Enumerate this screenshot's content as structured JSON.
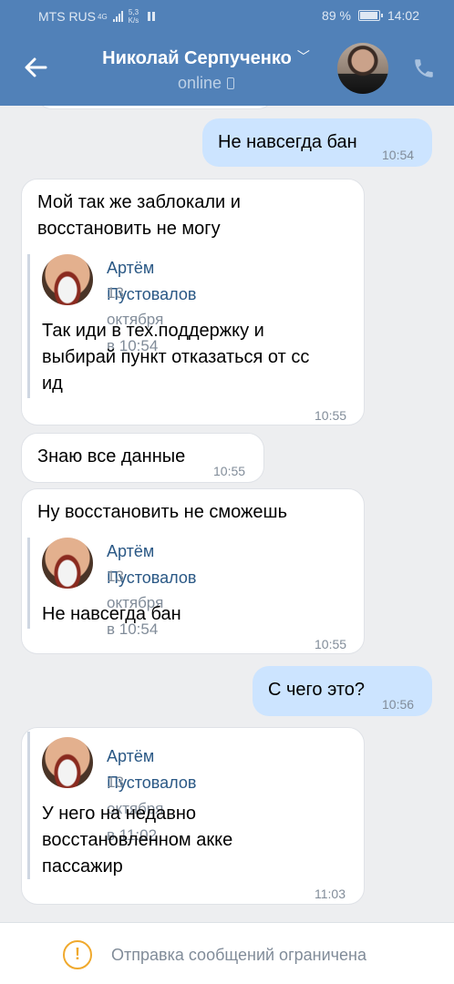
{
  "status_bar": {
    "carrier": "MTS RUS",
    "network": "4G",
    "speed_value": "5,3",
    "speed_unit": "K/s",
    "battery": "89 %",
    "time": "14:02"
  },
  "header": {
    "name": "Николай Серпученко",
    "status": "online",
    "icons": [
      "back-arrow-icon",
      "chevron-down-icon",
      "mobile-icon",
      "phone-icon"
    ]
  },
  "messages": [
    {
      "text": "Не навсегда бан",
      "time": "10:54"
    },
    {
      "text_lines": [
        "Мой так же заблокали и",
        "восстановить не могу"
      ],
      "quote": {
        "author": "Артём Пустовалов",
        "date": "13 октября в 10:54",
        "text_lines": [
          "Так иди в тех.поддержку и",
          "выбирай пункт отказаться от сс",
          "ид"
        ]
      },
      "time": "10:55"
    },
    {
      "text": "Знаю все данные",
      "time": "10:55"
    },
    {
      "text": "Ну восстановить не сможешь",
      "quote": {
        "author": "Артём Пустовалов",
        "date": "13 октября в 10:54",
        "text": "Не навсегда бан"
      },
      "time": "10:55"
    },
    {
      "text": "С чего это?",
      "time": "10:56"
    },
    {
      "quote": {
        "author": "Артём Пустовалов",
        "date": "13 октября в 11:02",
        "text_lines": [
          "У него на недавно",
          "восстановленном акке",
          "пассажир"
        ]
      },
      "time": "11:03"
    }
  ],
  "footer": {
    "text": "Отправка сообщений ограничена"
  },
  "colors": {
    "header": "#5181b8",
    "outgoing": "#cce4ff",
    "link": "#2a5885",
    "warning": "#f0a92d"
  }
}
